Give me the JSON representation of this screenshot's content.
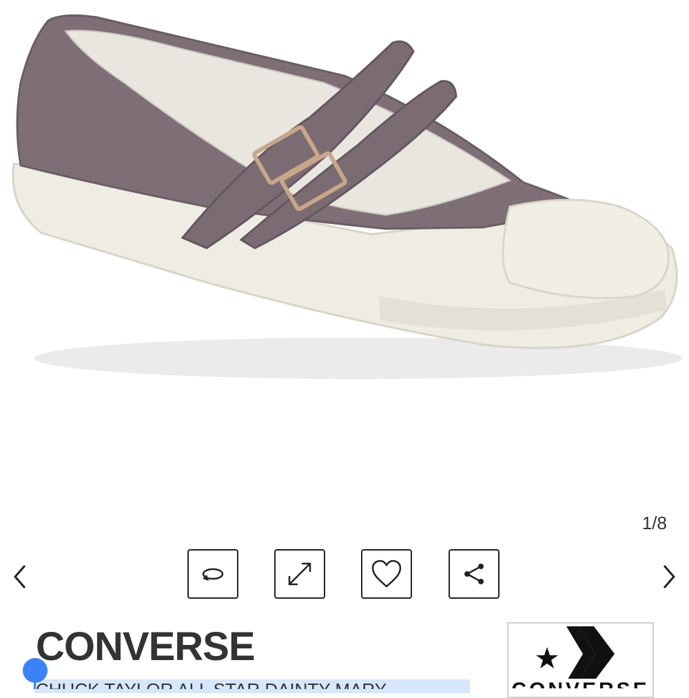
{
  "gallery": {
    "counter": "1/8",
    "image_alt": "Grey canvas Mary Jane sneaker with double buckle straps and white rubber toe cap",
    "prev_icon": "chevron-left-icon",
    "next_icon": "chevron-right-icon"
  },
  "toolbar": {
    "buttons": [
      {
        "name": "rotate-360",
        "icon": "rotate-icon"
      },
      {
        "name": "fullscreen",
        "icon": "expand-icon"
      },
      {
        "name": "favorite",
        "icon": "heart-icon"
      },
      {
        "name": "share",
        "icon": "share-icon"
      }
    ]
  },
  "product": {
    "brand": "CONVERSE",
    "title": "CHUCK TAYLOR ALL STAR DAINTY MARY",
    "logo_text": "CONVERSE",
    "logo_icon": "star-chevron-icon"
  },
  "colors": {
    "shoe_canvas": "#7d6f75",
    "sole": "#efece3",
    "selection": "#d6e6fb",
    "selection_handle": "#3b82f6"
  }
}
